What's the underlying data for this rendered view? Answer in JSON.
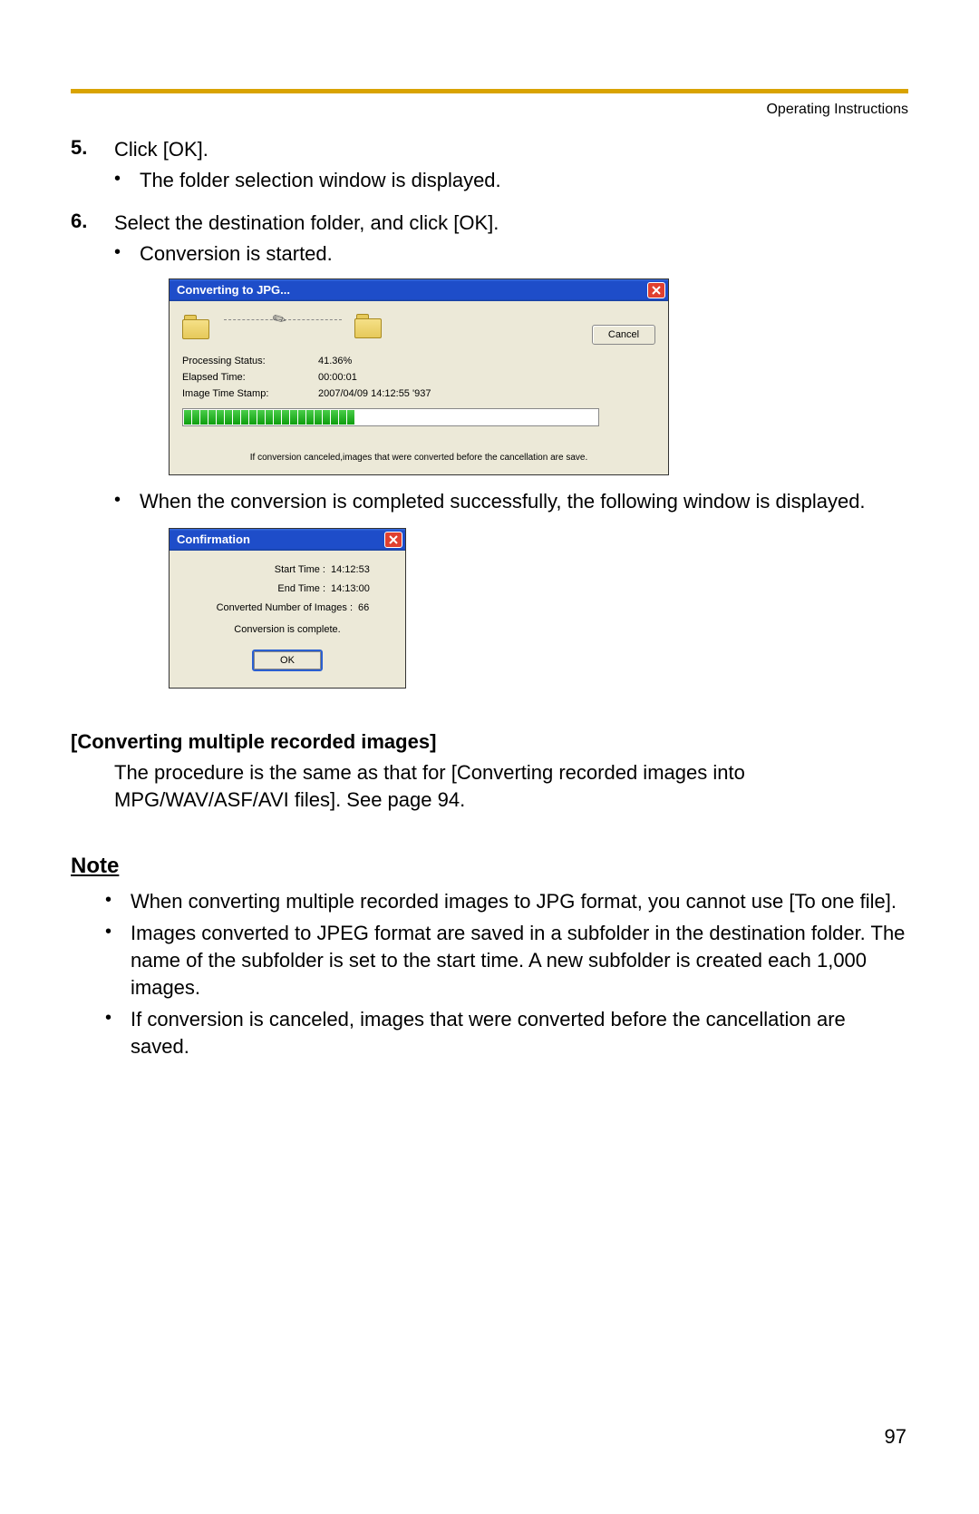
{
  "header": {
    "right": "Operating Instructions"
  },
  "steps": {
    "s5": {
      "num": "5.",
      "text": "Click [OK].",
      "bullets": [
        "The folder selection window is displayed."
      ]
    },
    "s6": {
      "num": "6.",
      "text": "Select the destination folder, and click [OK].",
      "bullets_a": [
        "Conversion is started."
      ],
      "bullets_b": [
        "When the conversion is completed successfully, the following window is displayed."
      ]
    }
  },
  "dialog1": {
    "title": "Converting to JPG...",
    "cancel": "Cancel",
    "rows": {
      "r1": {
        "label": "Processing Status:",
        "value": "41.36%"
      },
      "r2": {
        "label": "Elapsed Time:",
        "value": "00:00:01"
      },
      "r3": {
        "label": "Image Time Stamp:",
        "value": "2007/04/09 14:12:55 '937"
      }
    },
    "footnote": "If conversion canceled,images that were converted before the cancellation are save."
  },
  "dialog2": {
    "title": "Confirmation",
    "rows": {
      "r1": {
        "label": "Start Time :",
        "value": "14:12:53"
      },
      "r2": {
        "label": "End Time :",
        "value": "14:13:00"
      },
      "r3": {
        "label": "Converted Number of Images :",
        "value": "66"
      }
    },
    "complete": "Conversion is complete.",
    "ok": "OK"
  },
  "section": {
    "heading": "[Converting multiple recorded images]",
    "text": "The procedure is the same as that for [Converting recorded images into MPG/WAV/ASF/AVI files]. See page 94."
  },
  "note": {
    "heading": "Note",
    "items": [
      "When converting multiple recorded images to JPG format, you cannot use [To one file].",
      "Images converted to JPEG format are saved in a subfolder in the destination folder. The name of the subfolder is set to the start time. A new subfolder is created each 1,000 images.",
      "If conversion is canceled, images that were converted before the cancellation are saved."
    ]
  },
  "page_number": "97"
}
